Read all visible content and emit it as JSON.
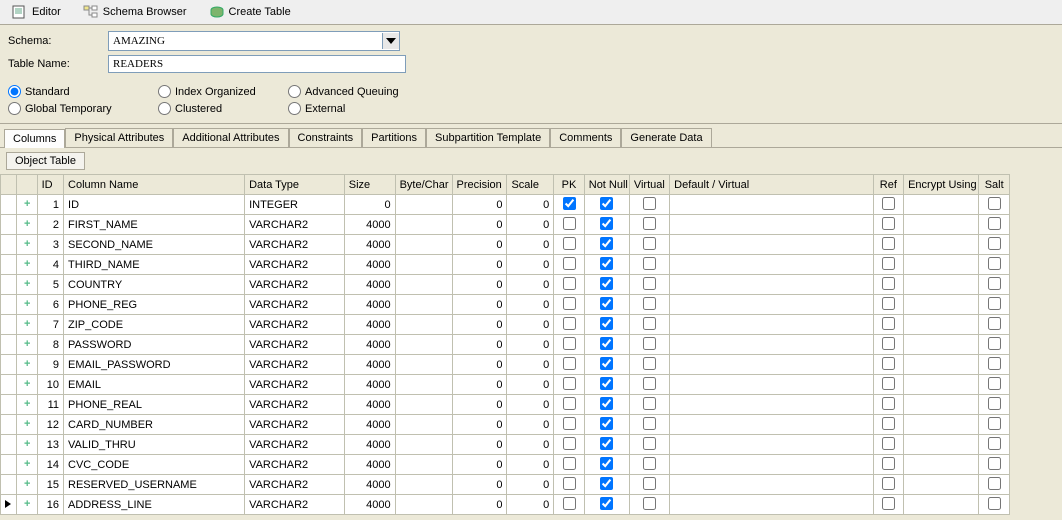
{
  "toolbar": {
    "editor": "Editor",
    "schema_browser": "Schema Browser",
    "create_table": "Create Table"
  },
  "form": {
    "schema_label": "Schema:",
    "schema_value": "AMAZING",
    "tablename_label": "Table Name:",
    "tablename_value": "READERS"
  },
  "tabletype": {
    "standard": "Standard",
    "index_organized": "Index Organized",
    "advanced_queuing": "Advanced Queuing",
    "global_temporary": "Global Temporary",
    "clustered": "Clustered",
    "external": "External"
  },
  "tabs": {
    "columns": "Columns",
    "physical": "Physical Attributes",
    "additional": "Additional Attributes",
    "constraints": "Constraints",
    "partitions": "Partitions",
    "subpart": "Subpartition Template",
    "comments": "Comments",
    "gendata": "Generate Data"
  },
  "subtab": {
    "object_table": "Object Table"
  },
  "headers": {
    "id": "ID",
    "colname": "Column Name",
    "dtype": "Data Type",
    "size": "Size",
    "bytechar": "Byte/Char",
    "precision": "Precision",
    "scale": "Scale",
    "pk": "PK",
    "notnull": "Not Null",
    "virtual": "Virtual",
    "defvirt": "Default / Virtual",
    "ref": "Ref",
    "encrypt": "Encrypt Using",
    "salt": "Salt"
  },
  "rows": [
    {
      "id": 1,
      "name": "ID",
      "type": "INTEGER",
      "size": 0,
      "bc": "",
      "prec": 0,
      "scale": 0,
      "pk": true,
      "nn": true,
      "virt": false,
      "dv": "",
      "ref": false,
      "enc": "",
      "salt": false
    },
    {
      "id": 2,
      "name": "FIRST_NAME",
      "type": "VARCHAR2",
      "size": 4000,
      "bc": "",
      "prec": 0,
      "scale": 0,
      "pk": false,
      "nn": true,
      "virt": false,
      "dv": "",
      "ref": false,
      "enc": "",
      "salt": false
    },
    {
      "id": 3,
      "name": "SECOND_NAME",
      "type": "VARCHAR2",
      "size": 4000,
      "bc": "",
      "prec": 0,
      "scale": 0,
      "pk": false,
      "nn": true,
      "virt": false,
      "dv": "",
      "ref": false,
      "enc": "",
      "salt": false
    },
    {
      "id": 4,
      "name": "THIRD_NAME",
      "type": "VARCHAR2",
      "size": 4000,
      "bc": "",
      "prec": 0,
      "scale": 0,
      "pk": false,
      "nn": true,
      "virt": false,
      "dv": "",
      "ref": false,
      "enc": "",
      "salt": false
    },
    {
      "id": 5,
      "name": "COUNTRY",
      "type": "VARCHAR2",
      "size": 4000,
      "bc": "",
      "prec": 0,
      "scale": 0,
      "pk": false,
      "nn": true,
      "virt": false,
      "dv": "",
      "ref": false,
      "enc": "",
      "salt": false
    },
    {
      "id": 6,
      "name": "PHONE_REG",
      "type": "VARCHAR2",
      "size": 4000,
      "bc": "",
      "prec": 0,
      "scale": 0,
      "pk": false,
      "nn": true,
      "virt": false,
      "dv": "",
      "ref": false,
      "enc": "",
      "salt": false
    },
    {
      "id": 7,
      "name": "ZIP_CODE",
      "type": "VARCHAR2",
      "size": 4000,
      "bc": "",
      "prec": 0,
      "scale": 0,
      "pk": false,
      "nn": true,
      "virt": false,
      "dv": "",
      "ref": false,
      "enc": "",
      "salt": false
    },
    {
      "id": 8,
      "name": "PASSWORD",
      "type": "VARCHAR2",
      "size": 4000,
      "bc": "",
      "prec": 0,
      "scale": 0,
      "pk": false,
      "nn": true,
      "virt": false,
      "dv": "",
      "ref": false,
      "enc": "",
      "salt": false
    },
    {
      "id": 9,
      "name": "EMAIL_PASSWORD",
      "type": "VARCHAR2",
      "size": 4000,
      "bc": "",
      "prec": 0,
      "scale": 0,
      "pk": false,
      "nn": true,
      "virt": false,
      "dv": "",
      "ref": false,
      "enc": "",
      "salt": false
    },
    {
      "id": 10,
      "name": "EMAIL",
      "type": "VARCHAR2",
      "size": 4000,
      "bc": "",
      "prec": 0,
      "scale": 0,
      "pk": false,
      "nn": true,
      "virt": false,
      "dv": "",
      "ref": false,
      "enc": "",
      "salt": false
    },
    {
      "id": 11,
      "name": "PHONE_REAL",
      "type": "VARCHAR2",
      "size": 4000,
      "bc": "",
      "prec": 0,
      "scale": 0,
      "pk": false,
      "nn": true,
      "virt": false,
      "dv": "",
      "ref": false,
      "enc": "",
      "salt": false
    },
    {
      "id": 12,
      "name": "CARD_NUMBER",
      "type": "VARCHAR2",
      "size": 4000,
      "bc": "",
      "prec": 0,
      "scale": 0,
      "pk": false,
      "nn": true,
      "virt": false,
      "dv": "",
      "ref": false,
      "enc": "",
      "salt": false
    },
    {
      "id": 13,
      "name": "VALID_THRU",
      "type": "VARCHAR2",
      "size": 4000,
      "bc": "",
      "prec": 0,
      "scale": 0,
      "pk": false,
      "nn": true,
      "virt": false,
      "dv": "",
      "ref": false,
      "enc": "",
      "salt": false
    },
    {
      "id": 14,
      "name": "CVC_CODE",
      "type": "VARCHAR2",
      "size": 4000,
      "bc": "",
      "prec": 0,
      "scale": 0,
      "pk": false,
      "nn": true,
      "virt": false,
      "dv": "",
      "ref": false,
      "enc": "",
      "salt": false
    },
    {
      "id": 15,
      "name": "RESERVED_USERNAME",
      "type": "VARCHAR2",
      "size": 4000,
      "bc": "",
      "prec": 0,
      "scale": 0,
      "pk": false,
      "nn": true,
      "virt": false,
      "dv": "",
      "ref": false,
      "enc": "",
      "salt": false
    },
    {
      "id": 16,
      "name": "ADDRESS_LINE",
      "type": "VARCHAR2",
      "size": 4000,
      "bc": "",
      "prec": 0,
      "scale": 0,
      "pk": false,
      "nn": true,
      "virt": false,
      "dv": "",
      "ref": false,
      "enc": "",
      "salt": false
    }
  ],
  "current_row": 16
}
